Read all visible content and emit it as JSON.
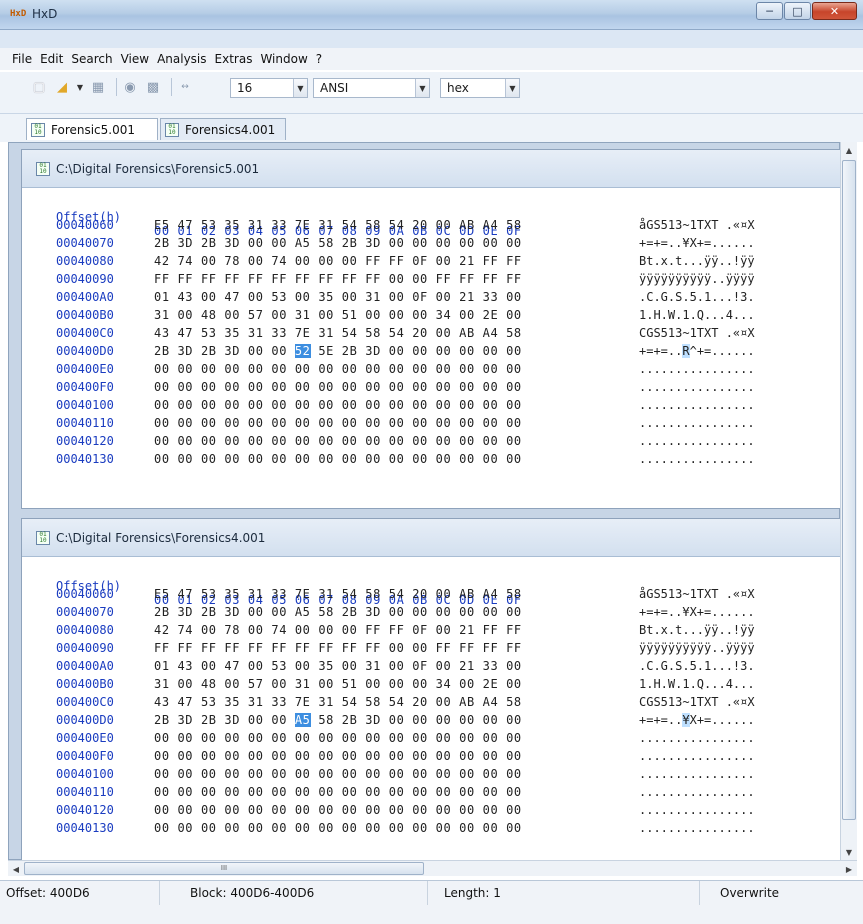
{
  "window": {
    "title": "HxD"
  },
  "menu": [
    "File",
    "Edit",
    "Search",
    "View",
    "Analysis",
    "Extras",
    "Window",
    "?"
  ],
  "toolbar": {
    "bytes_per_row": "16",
    "charset": "ANSI",
    "display_mode": "hex"
  },
  "tabs": [
    "Forensic5.001",
    "Forensics4.001"
  ],
  "hex_header": {
    "offset_label": "Offset(h)",
    "columns": "00 01 02 03 04 05 06 07 08 09 0A 0B 0C 0D 0E 0F"
  },
  "panels": [
    {
      "path": "C:\\Digital Forensics\\Forensic5.001",
      "rows": [
        {
          "offset": "00040060",
          "hex": "E5 47 53 35 31 33 7E 31 54 58 54 20 00 AB A4 58",
          "ascii": "åGS513~1TXT .«¤X"
        },
        {
          "offset": "00040070",
          "hex": "2B 3D 2B 3D 00 00 A5 58 2B 3D 00 00 00 00 00 00",
          "ascii": "+=+=..¥X+=......"
        },
        {
          "offset": "00040080",
          "hex": "42 74 00 78 00 74 00 00 00 FF FF 0F 00 21 FF FF",
          "ascii": "Bt.x.t...ÿÿ..!ÿÿ"
        },
        {
          "offset": "00040090",
          "hex": "FF FF FF FF FF FF FF FF FF FF 00 00 FF FF FF FF",
          "ascii": "ÿÿÿÿÿÿÿÿÿÿ..ÿÿÿÿ"
        },
        {
          "offset": "000400A0",
          "hex": "01 43 00 47 00 53 00 35 00 31 00 0F 00 21 33 00",
          "ascii": ".C.G.S.5.1...!3."
        },
        {
          "offset": "000400B0",
          "hex": "31 00 48 00 57 00 31 00 51 00 00 00 34 00 2E 00",
          "ascii": "1.H.W.1.Q...4..."
        },
        {
          "offset": "000400C0",
          "hex": "43 47 53 35 31 33 7E 31 54 58 54 20 00 AB A4 58",
          "ascii": "CGS513~1TXT .«¤X"
        },
        {
          "offset": "000400D0",
          "hex_pre": "2B 3D 2B 3D 00 00 ",
          "hex_hl": "52",
          "hex_post": " 5E 2B 3D 00 00 00 00 00 00",
          "ascii_pre": "+=+=..",
          "ascii_hl": "R",
          "ascii_post": "^+=......"
        },
        {
          "offset": "000400E0",
          "hex": "00 00 00 00 00 00 00 00 00 00 00 00 00 00 00 00",
          "ascii": "................"
        },
        {
          "offset": "000400F0",
          "hex": "00 00 00 00 00 00 00 00 00 00 00 00 00 00 00 00",
          "ascii": "................"
        },
        {
          "offset": "00040100",
          "hex": "00 00 00 00 00 00 00 00 00 00 00 00 00 00 00 00",
          "ascii": "................"
        },
        {
          "offset": "00040110",
          "hex": "00 00 00 00 00 00 00 00 00 00 00 00 00 00 00 00",
          "ascii": "................"
        },
        {
          "offset": "00040120",
          "hex": "00 00 00 00 00 00 00 00 00 00 00 00 00 00 00 00",
          "ascii": "................"
        },
        {
          "offset": "00040130",
          "hex": "00 00 00 00 00 00 00 00 00 00 00 00 00 00 00 00",
          "ascii": "................"
        }
      ]
    },
    {
      "path": "C:\\Digital Forensics\\Forensics4.001",
      "rows": [
        {
          "offset": "00040060",
          "hex": "E5 47 53 35 31 33 7E 31 54 58 54 20 00 AB A4 58",
          "ascii": "åGS513~1TXT .«¤X"
        },
        {
          "offset": "00040070",
          "hex": "2B 3D 2B 3D 00 00 A5 58 2B 3D 00 00 00 00 00 00",
          "ascii": "+=+=..¥X+=......"
        },
        {
          "offset": "00040080",
          "hex": "42 74 00 78 00 74 00 00 00 FF FF 0F 00 21 FF FF",
          "ascii": "Bt.x.t...ÿÿ..!ÿÿ"
        },
        {
          "offset": "00040090",
          "hex": "FF FF FF FF FF FF FF FF FF FF 00 00 FF FF FF FF",
          "ascii": "ÿÿÿÿÿÿÿÿÿÿ..ÿÿÿÿ"
        },
        {
          "offset": "000400A0",
          "hex": "01 43 00 47 00 53 00 35 00 31 00 0F 00 21 33 00",
          "ascii": ".C.G.S.5.1...!3."
        },
        {
          "offset": "000400B0",
          "hex": "31 00 48 00 57 00 31 00 51 00 00 00 34 00 2E 00",
          "ascii": "1.H.W.1.Q...4..."
        },
        {
          "offset": "000400C0",
          "hex": "43 47 53 35 31 33 7E 31 54 58 54 20 00 AB A4 58",
          "ascii": "CGS513~1TXT .«¤X"
        },
        {
          "offset": "000400D0",
          "hex_pre": "2B 3D 2B 3D 00 00 ",
          "hex_hl": "A5",
          "hex_post": " 58 2B 3D 00 00 00 00 00 00",
          "ascii_pre": "+=+=..",
          "ascii_hl": "¥",
          "ascii_post": "X+=......"
        },
        {
          "offset": "000400E0",
          "hex": "00 00 00 00 00 00 00 00 00 00 00 00 00 00 00 00",
          "ascii": "................"
        },
        {
          "offset": "000400F0",
          "hex": "00 00 00 00 00 00 00 00 00 00 00 00 00 00 00 00",
          "ascii": "................"
        },
        {
          "offset": "00040100",
          "hex": "00 00 00 00 00 00 00 00 00 00 00 00 00 00 00 00",
          "ascii": "................"
        },
        {
          "offset": "00040110",
          "hex": "00 00 00 00 00 00 00 00 00 00 00 00 00 00 00 00",
          "ascii": "................"
        },
        {
          "offset": "00040120",
          "hex": "00 00 00 00 00 00 00 00 00 00 00 00 00 00 00 00",
          "ascii": "................"
        },
        {
          "offset": "00040130",
          "hex": "00 00 00 00 00 00 00 00 00 00 00 00 00 00 00 00",
          "ascii": "................"
        }
      ]
    }
  ],
  "status": {
    "offset": "Offset: 400D6",
    "block": "Block: 400D6-400D6",
    "length": "Length: 1",
    "mode": "Overwrite"
  },
  "colors": {
    "offset_blue": "#1a3cc0",
    "selection": "#3d8ee0"
  }
}
